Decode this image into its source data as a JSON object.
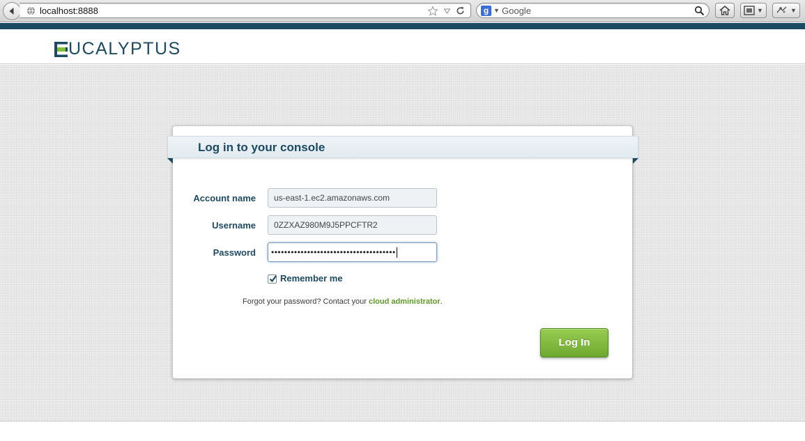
{
  "browser": {
    "url": "localhost:8888",
    "search_placeholder": "Google",
    "search_engine_letter": "g"
  },
  "header": {
    "logo_text": "UCALYPTUS",
    "logo_full": "EUCALYPTUS"
  },
  "login": {
    "title": "Log in to your console",
    "fields": [
      {
        "label": "Account name",
        "value": "us-east-1.ec2.amazonaws.com"
      },
      {
        "label": "Username",
        "value": "0ZZXAZ980M9J5PPCFTR2"
      },
      {
        "label": "Password",
        "value": "••••••••••••••••••••••••••••••••••••••"
      }
    ],
    "remember_label": "Remember me",
    "remember_checked": true,
    "forgot_prefix": "Forgot your password? Contact your ",
    "forgot_link": "cloud administrator",
    "forgot_suffix": ".",
    "button_label": "Log In"
  },
  "colors": {
    "brand": "#1d4a63",
    "button": "#7db63a",
    "link": "#5e9a2a"
  },
  "icons": [
    "back-arrow-icon",
    "globe-icon",
    "bookmark-star-icon",
    "dropdown-icon",
    "reload-icon",
    "google-icon",
    "search-icon",
    "home-icon",
    "screenshot-icon",
    "extension-icon",
    "checkbox-checked-icon"
  ]
}
